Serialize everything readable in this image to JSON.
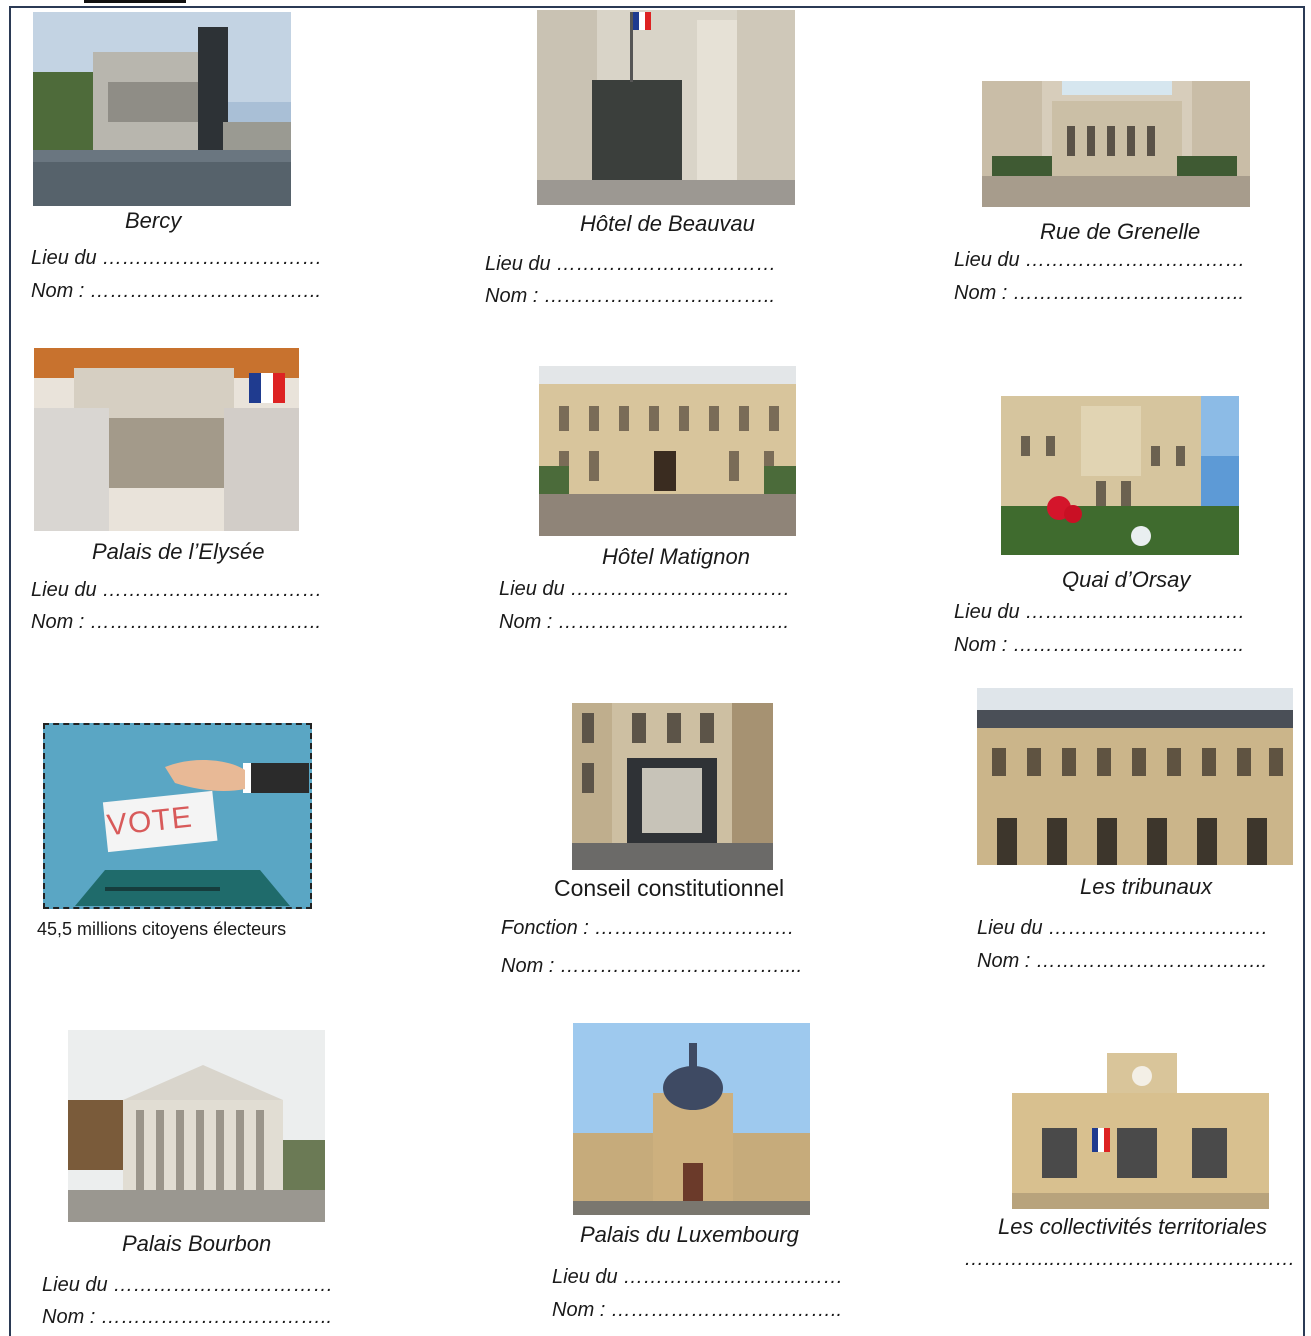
{
  "cards": [
    {
      "caption": "Bercy",
      "line1": "Lieu du ……………………………",
      "line2": "Nom : ……………………………..",
      "image": "bercy-photo"
    },
    {
      "caption": "Hôtel de Beauvau",
      "line1": "Lieu du ……………………………",
      "line2": "Nom : ……………………………..",
      "image": "beauvau-photo"
    },
    {
      "caption": "Rue de Grenelle",
      "line1": "Lieu du ……………………………",
      "line2": "Nom : ……………………………..",
      "image": "grenelle-photo"
    },
    {
      "caption": "Palais de l’Elysée",
      "line1": "Lieu du ……………………………",
      "line2": "Nom : ……………………………..",
      "image": "elysee-photo"
    },
    {
      "caption": "Hôtel Matignon",
      "line1": "Lieu du ……………………………",
      "line2": "Nom : ……………………………..",
      "image": "matignon-photo"
    },
    {
      "caption": "Quai d’Orsay",
      "line1": "Lieu du ……………………………",
      "line2": "Nom : ……………………………..",
      "image": "orsay-photo"
    },
    {
      "caption": "45,5 millions citoyens électeurs",
      "image": "vote-illustration",
      "vote_text": "VOTE"
    },
    {
      "caption": "Conseil constitutionnel",
      "line1": "Fonction : …………………………",
      "line2": "Nom : ……………………………....",
      "image": "conseil-photo"
    },
    {
      "caption": "Les tribunaux",
      "line1": "Lieu du ……………………………",
      "line2": "Nom : ……………………………..",
      "image": "tribunaux-photo"
    },
    {
      "caption": "Palais Bourbon",
      "line1": "Lieu du ……………………………",
      "line2": "Nom : ……………………………..",
      "image": "bourbon-photo"
    },
    {
      "caption": "Palais du Luxembourg",
      "line1": "Lieu du ……………………………",
      "line2": "Nom : ……………………………..",
      "image": "luxembourg-photo"
    },
    {
      "caption": "Les collectivités territoriales",
      "line1": "…………..………………………………",
      "image": "collectivites-photo"
    }
  ]
}
